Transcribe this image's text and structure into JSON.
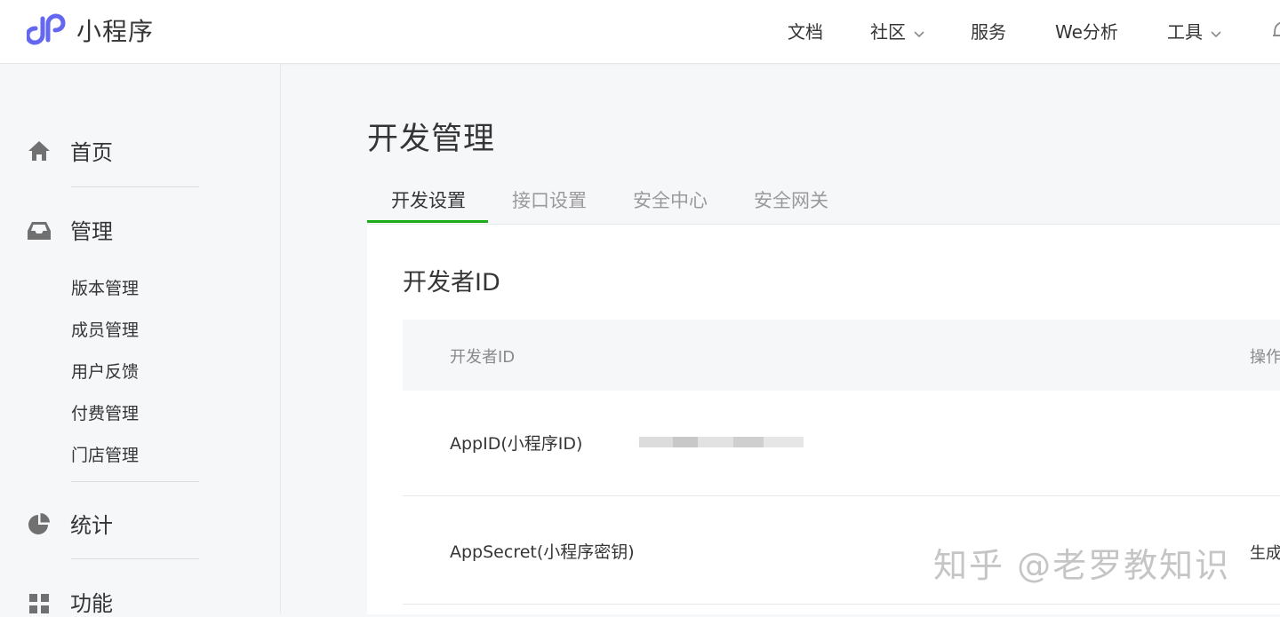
{
  "app": {
    "brand": "小程序"
  },
  "topnav": {
    "docs": "文档",
    "community": "社区",
    "service": "服务",
    "analytics": "We分析",
    "tools": "工具"
  },
  "sidebar": {
    "home": "首页",
    "manage": "管理",
    "manage_items": [
      "版本管理",
      "成员管理",
      "用户反馈",
      "付费管理",
      "门店管理"
    ],
    "stats": "统计",
    "features": "功能"
  },
  "main": {
    "title": "开发管理",
    "tabs": [
      "开发设置",
      "接口设置",
      "安全中心",
      "安全网关"
    ],
    "active_tab": "开发设置",
    "section_title": "开发者ID",
    "table": {
      "headers": [
        "开发者ID",
        "操作"
      ],
      "rows": [
        {
          "label": "AppID(小程序ID)",
          "value_masked": true,
          "action": ""
        },
        {
          "label": "AppSecret(小程序密钥)",
          "action": "生成"
        }
      ]
    }
  },
  "watermark": "知乎 @老罗教知识",
  "colors": {
    "accent_green": "#1aad19",
    "logo_purple": "#6467f0",
    "text": "#353535",
    "muted": "#9a9a9a"
  }
}
